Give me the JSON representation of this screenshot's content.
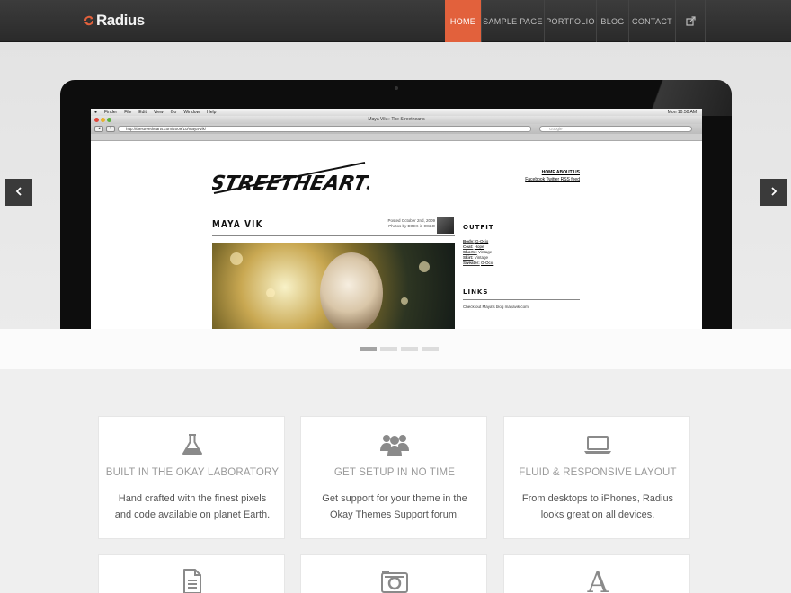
{
  "header": {
    "logo_text": "Radius",
    "nav": [
      {
        "label": "HOME",
        "active": true
      },
      {
        "label": "SAMPLE PAGE",
        "active": false
      },
      {
        "label": "PORTFOLIO",
        "active": false
      },
      {
        "label": "BLOG",
        "active": false
      },
      {
        "label": "CONTACT",
        "active": false
      }
    ],
    "external_icon": "external-link-icon"
  },
  "slider": {
    "prev_icon": "chevron-left-icon",
    "next_icon": "chevron-right-icon",
    "slide_count": 4,
    "active_slide": 1,
    "screen": {
      "mac_menu": [
        "Finder",
        "File",
        "Edit",
        "View",
        "Go",
        "Window",
        "Help"
      ],
      "clock": "Mon 10:50 AM",
      "browser_title": "Maya Vik » The Streethearts",
      "url": "http://thestreethearts.com/2009/10/maya-vik/",
      "search_placeholder": "Google",
      "site_links_top": "HOME ABOUT US",
      "site_links_bottom": "Facebook Twitter RSS feed",
      "post_title": "MAYA VIK",
      "post_meta_1": "Posted October 2nd, 2009",
      "post_meta_2": "Photos by DIRIK in OSLO",
      "outfit_heading": "OUTFIT",
      "outfit_items": [
        {
          "label": "Body:",
          "value": "G-Ocio"
        },
        {
          "label": "Coat:",
          "value": "Hope"
        },
        {
          "label": "Shorts:",
          "value": "Vintage"
        },
        {
          "label": "Skirt:",
          "value": "Vintage"
        },
        {
          "label": "Sweater:",
          "value": "G-Ocio"
        }
      ],
      "links_heading": "LINKS",
      "links_text": "Check out Maya's blog mayavik.com"
    }
  },
  "features": [
    {
      "icon": "flask-icon",
      "title": "BUILT IN THE OKAY LABORATORY",
      "text": "Hand crafted with the finest pixels and code available on planet Earth."
    },
    {
      "icon": "users-icon",
      "title": "GET SETUP IN NO TIME",
      "text": "Get support for your theme in the Okay Themes Support forum."
    },
    {
      "icon": "laptop-icon",
      "title": "FLUID & RESPONSIVE LAYOUT",
      "text": "From desktops to iPhones, Radius looks great on all devices."
    },
    {
      "icon": "document-icon"
    },
    {
      "icon": "camera-icon"
    },
    {
      "icon": "font-icon"
    }
  ],
  "colors": {
    "accent": "#e2613c",
    "topbar": "#333333",
    "card_title": "#9a9a9a"
  }
}
